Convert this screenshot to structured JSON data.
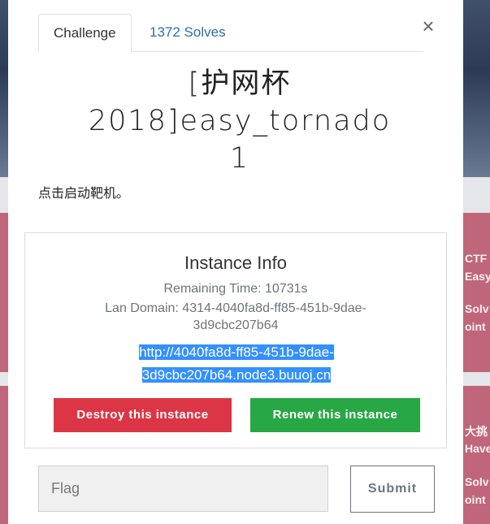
{
  "background": {
    "cards": [
      {
        "lines": [
          "CTF",
          "Easy",
          "Solv",
          "oint"
        ]
      },
      {
        "lines": [
          "大挑",
          "Have",
          "Solv",
          "oint"
        ]
      }
    ]
  },
  "modal": {
    "tabs": [
      {
        "label": "Challenge",
        "active": true
      },
      {
        "label": "1372 Solves",
        "active": false
      }
    ],
    "close_icon": "close-icon",
    "title": "[护网杯2018]easy_tornado 1",
    "description": "点击启动靶机。",
    "instance": {
      "heading": "Instance Info",
      "remaining_time": "Remaining Time: 10731s",
      "lan_domain": "Lan Domain: 4314-4040fa8d-ff85-451b-9dae-3d9cbc207b64",
      "link": "http://4040fa8d-ff85-451b-9dae-3d9cbc207b64.node3.buuoj.cn",
      "destroy_label": "Destroy this instance",
      "renew_label": "Renew this instance"
    },
    "flag": {
      "placeholder": "Flag",
      "value": ""
    },
    "submit_label": "Submit"
  },
  "colors": {
    "destroy": "#dc3545",
    "renew": "#28a745",
    "link_highlight": "#3390ff",
    "tab_link": "#2a6fb0"
  }
}
